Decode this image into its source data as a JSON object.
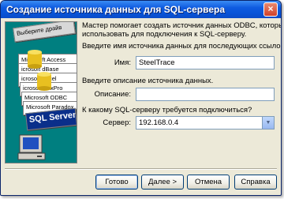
{
  "window": {
    "title": "Создание источника данных для SQL-сервера",
    "close_glyph": "×"
  },
  "side_image": {
    "cards": [
      "Выберите драйв",
      "Microsoft Access",
      "icrosoft dBase",
      "icrosoft Excel",
      "icrosoft FoxPro",
      "Microsoft ODBC",
      "Microsoft Paradox",
      "SQL Server"
    ]
  },
  "intro": {
    "line1": "Мастер помогает создать источник данных ODBC, который можно",
    "line2": "использовать для подключения к SQL-серверу."
  },
  "name_prompt": "Введите имя источника данных для последующих ссылок на него.",
  "name_label": "Имя:",
  "name_value": "SteelTrace",
  "description_prompt": "Введите описание источника данных.",
  "description_label": "Описание:",
  "description_value": "",
  "server_prompt": "К какому SQL-серверу требуется подключиться?",
  "server_label": "Сервер:",
  "server_value": "192.168.0.4",
  "buttons": {
    "finish": "Готово",
    "next": "Далее >",
    "cancel": "Отмена",
    "help": "Справка"
  },
  "colors": {
    "titlebar": "#0a4bc8",
    "dialog": "#ece9d8",
    "image_bg": "#007f80"
  }
}
